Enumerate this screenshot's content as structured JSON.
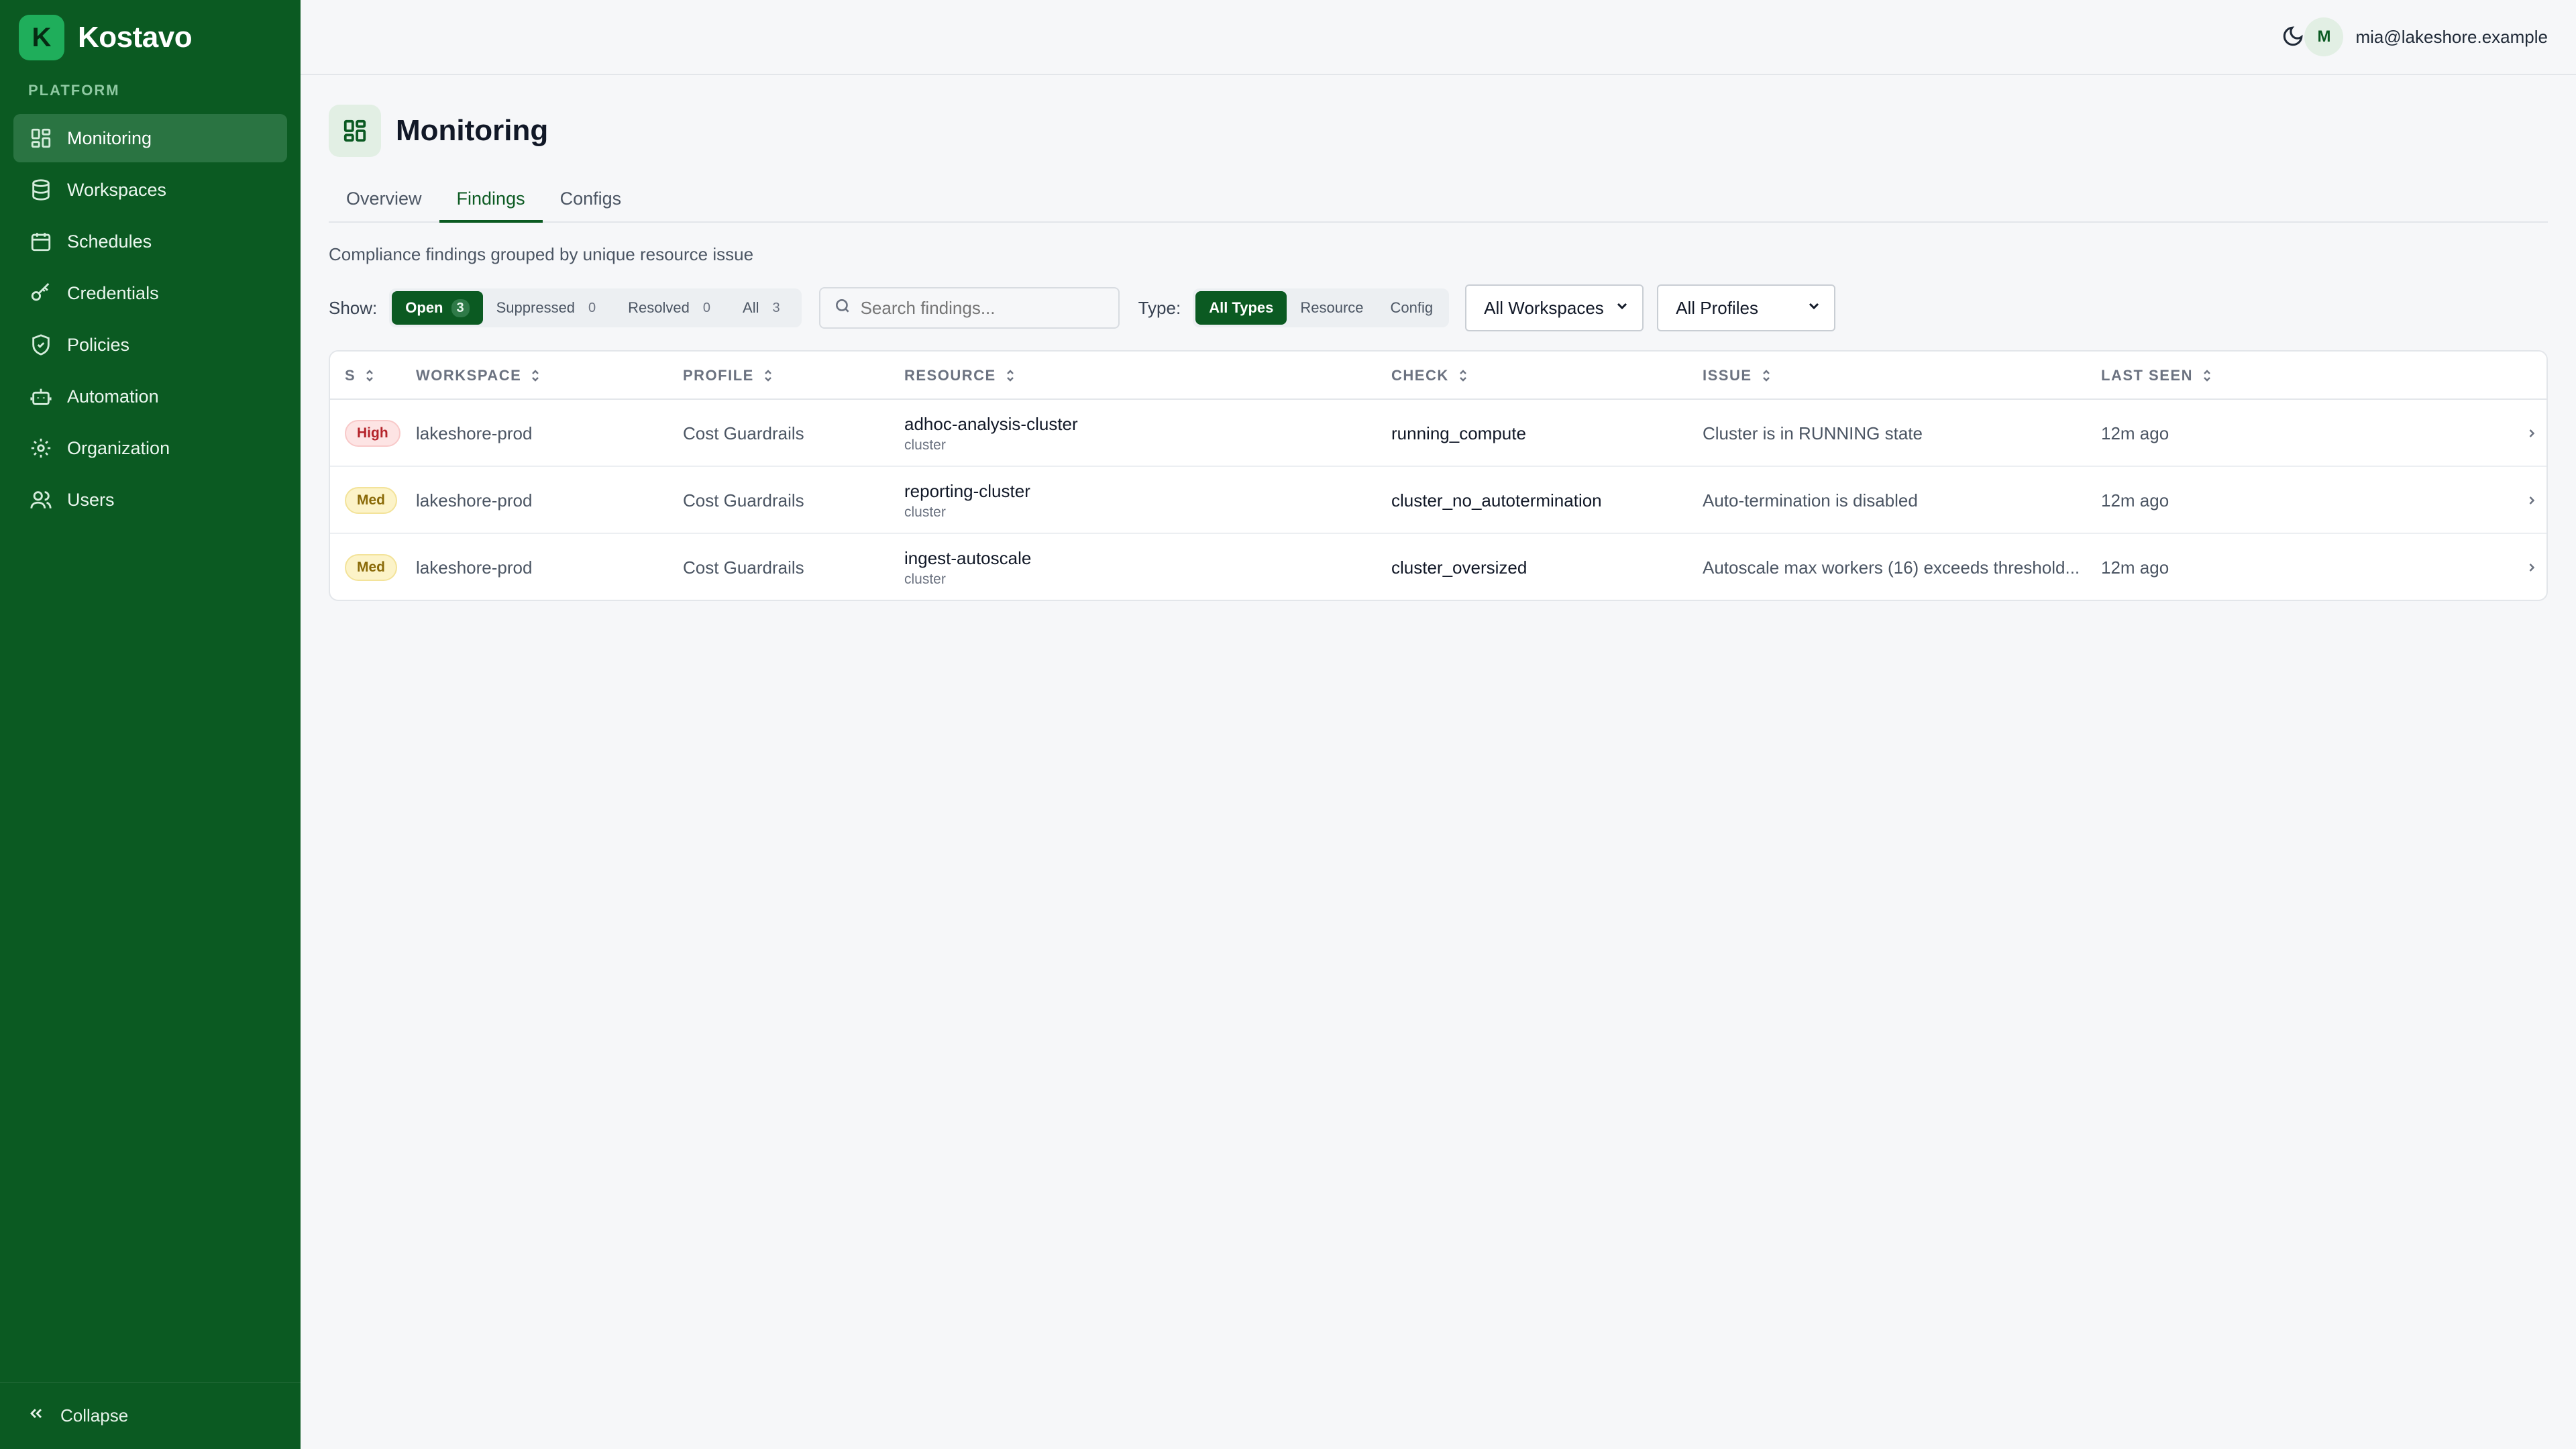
{
  "brand": {
    "logo_letter": "K",
    "name": "Kostavo"
  },
  "sidebar": {
    "section_label": "PLATFORM",
    "items": [
      {
        "label": "Monitoring",
        "icon": "dashboard-icon",
        "active": true
      },
      {
        "label": "Workspaces",
        "icon": "database-icon"
      },
      {
        "label": "Schedules",
        "icon": "calendar-icon"
      },
      {
        "label": "Credentials",
        "icon": "key-icon"
      },
      {
        "label": "Policies",
        "icon": "shield-icon"
      },
      {
        "label": "Automation",
        "icon": "robot-icon"
      },
      {
        "label": "Organization",
        "icon": "gear-icon"
      },
      {
        "label": "Users",
        "icon": "users-icon"
      }
    ],
    "collapse_label": "Collapse"
  },
  "topbar": {
    "theme_toggle_icon": "moon-icon",
    "user_initial": "M",
    "user_email": "mia@lakeshore.example"
  },
  "page": {
    "title": "Monitoring",
    "icon": "dashboard-icon",
    "tabs": [
      {
        "label": "Overview"
      },
      {
        "label": "Findings",
        "active": true
      },
      {
        "label": "Configs"
      }
    ],
    "subtitle": "Compliance findings grouped by unique resource issue"
  },
  "filters": {
    "show_label": "Show:",
    "show_options": [
      {
        "label": "Open",
        "count": "3",
        "active": true
      },
      {
        "label": "Suppressed",
        "count": "0"
      },
      {
        "label": "Resolved",
        "count": "0"
      },
      {
        "label": "All",
        "count": "3"
      }
    ],
    "search_placeholder": "Search findings...",
    "type_label": "Type:",
    "type_options": [
      {
        "label": "All Types",
        "active": true
      },
      {
        "label": "Resource"
      },
      {
        "label": "Config"
      }
    ],
    "workspace_select": "All Workspaces",
    "profile_select": "All Profiles"
  },
  "table": {
    "columns": [
      "S",
      "WORKSPACE",
      "PROFILE",
      "RESOURCE",
      "CHECK",
      "ISSUE",
      "LAST SEEN"
    ],
    "rows": [
      {
        "severity": "High",
        "workspace": "lakeshore-prod",
        "profile": "Cost Guardrails",
        "resource": "adhoc-analysis-cluster",
        "resource_type": "cluster",
        "check": "running_compute",
        "issue": "Cluster is in RUNNING state",
        "last_seen": "12m ago"
      },
      {
        "severity": "Med",
        "workspace": "lakeshore-prod",
        "profile": "Cost Guardrails",
        "resource": "reporting-cluster",
        "resource_type": "cluster",
        "check": "cluster_no_autotermination",
        "issue": "Auto-termination is disabled",
        "last_seen": "12m ago"
      },
      {
        "severity": "Med",
        "workspace": "lakeshore-prod",
        "profile": "Cost Guardrails",
        "resource": "ingest-autoscale",
        "resource_type": "cluster",
        "check": "cluster_oversized",
        "issue": "Autoscale max workers (16) exceeds threshold...",
        "last_seen": "12m ago"
      }
    ]
  },
  "colors": {
    "sidebar_bg": "#0b5a22",
    "accent": "#0b5a22",
    "high_badge": "#fde4e4",
    "med_badge": "#fcf3c8"
  }
}
